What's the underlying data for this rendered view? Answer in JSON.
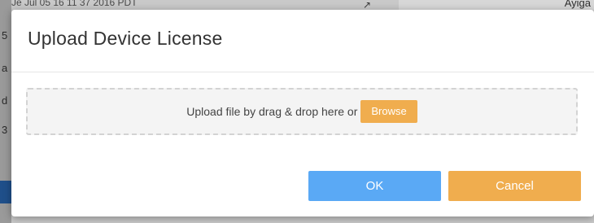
{
  "background": {
    "top_text": "Je Jul 05 16 11 37 2016 PDT",
    "right_text": "Ayiga",
    "left_fragments": [
      "5",
      "a",
      "d",
      "3"
    ]
  },
  "modal": {
    "title": "Upload Device License",
    "dropzone": {
      "text": "Upload file by drag & drop here or",
      "browse_label": "Browse"
    },
    "buttons": {
      "ok_label": "OK",
      "cancel_label": "Cancel"
    }
  },
  "colors": {
    "ok": "#5aa9f5",
    "cancel": "#f0ad4e",
    "browse": "#f0ad4e"
  }
}
